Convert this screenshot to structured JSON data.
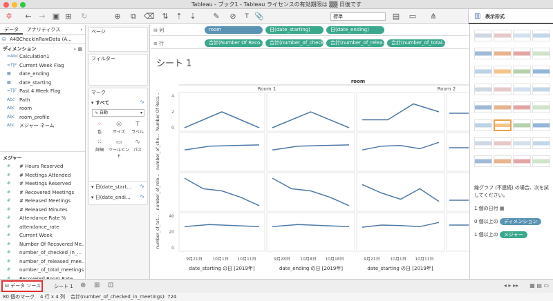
{
  "window": {
    "title": "Tableau - ブック1 - Tableau ライセンスの有効期限は ▒▒ 日後です"
  },
  "toolbar": {
    "mark_type_select": "標準",
    "show_me_label": "表示形式"
  },
  "left_panel": {
    "tabs": [
      "データ",
      "アナリティクス"
    ],
    "datasource": "A4BCheckInRawData (A...",
    "dimensions_header": "ディメンション",
    "dimensions": [
      {
        "icon": "=Abc",
        "name": "Calculation1"
      },
      {
        "icon": "T|F",
        "name": "Current Week Flag"
      },
      {
        "icon": "cal",
        "name": "date_ending"
      },
      {
        "icon": "cal",
        "name": "date_starting"
      },
      {
        "icon": "T|F",
        "name": "Past 4 Week Flag"
      },
      {
        "icon": "Abc",
        "name": "Path"
      },
      {
        "icon": "Abc",
        "name": "room"
      },
      {
        "icon": "Abc",
        "name": "room_profile"
      },
      {
        "icon": "Abc",
        "name": "メジャー ネーム"
      }
    ],
    "measures_header": "メジャー",
    "measures": [
      {
        "icon": "#",
        "name": "# Hours Reserved"
      },
      {
        "icon": "#",
        "name": "# Meetings Attended"
      },
      {
        "icon": "#",
        "name": "# Meetings Reserved"
      },
      {
        "icon": "#",
        "name": "# Recovered Meetings"
      },
      {
        "icon": "#",
        "name": "# Released Meetings"
      },
      {
        "icon": "#",
        "name": "# Released Minutes"
      },
      {
        "icon": "#",
        "name": "Attendance Rate %"
      },
      {
        "icon": "#",
        "name": "attendance_rate"
      },
      {
        "icon": "#",
        "name": "Current Week"
      },
      {
        "icon": "#",
        "name": "Number Of Recovered Me..."
      },
      {
        "icon": "#",
        "name": "number_of_checked_in_..."
      },
      {
        "icon": "#",
        "name": "number_of_released_mee..."
      },
      {
        "icon": "#",
        "name": "number_of_total_meetings"
      },
      {
        "icon": "#",
        "name": "Recovered Room Rate"
      }
    ]
  },
  "middle_panel": {
    "pages": "ページ",
    "filters": "フィルター",
    "marks": "マーク",
    "all": "すべて",
    "mark_type": "自動",
    "buttons": [
      "色",
      "サイズ",
      "ラベル",
      "詳細",
      "ツールヒント",
      "パス"
    ],
    "date_pills": [
      "日(date_start...",
      "日(date_endi..."
    ]
  },
  "shelves": {
    "columns_label": "列",
    "rows_label": "行",
    "columns": [
      "room",
      "日(date_starting)",
      "日(date_ending)"
    ],
    "rows": [
      "合計(Number Of Reco...",
      "合計(number_of_check...",
      "合計(number_of_relea...",
      "合計(number_of_total..."
    ]
  },
  "sheet": {
    "title": "シート 1",
    "top_header": "room",
    "rooms": [
      "Room 1",
      "Room 2"
    ],
    "row_axis_labels": [
      "Number Of Reco...",
      "number_of_che...",
      "number_of_rele...",
      "number_of_tot..."
    ],
    "ticks_row0": [
      "4",
      "2",
      "0"
    ],
    "ticks_row3": [
      "40",
      "20",
      "0"
    ],
    "x_ticks_start": [
      "9月21日",
      "10月1日",
      "10月11日"
    ],
    "x_ticks_end": [
      "9月28日",
      "10月8日",
      "10月18日"
    ],
    "x_label_start": "date_starting の日 [2019年]",
    "x_label_end": "date_ending の日 [2019年]"
  },
  "chart_data": {
    "type": "line",
    "series": [
      {
        "name": "Room 1 / date_starting / Number Of Recovered Meetings",
        "values": [
          0,
          2,
          0
        ]
      },
      {
        "name": "Room 1 / date_ending / Number Of Recovered Meetings",
        "values": [
          0,
          2,
          0
        ]
      },
      {
        "name": "Room 2 / date_starting / Number Of Recovered Meetings",
        "values": [
          1,
          1,
          3,
          2
        ]
      },
      {
        "name": "Room 1 / date_starting / number_of_checked_in",
        "values": [
          28,
          34,
          35,
          36
        ]
      },
      {
        "name": "Room 1 / date_ending / number_of_checked_in",
        "values": [
          28,
          34,
          35,
          36
        ]
      },
      {
        "name": "Room 2 / date_starting / number_of_checked_in",
        "values": [
          28,
          34,
          35,
          30,
          40
        ]
      },
      {
        "name": "Room 1 / date_starting / number_of_released",
        "values": [
          14,
          9,
          8,
          5,
          1
        ]
      },
      {
        "name": "Room 1 / date_ending / number_of_released",
        "values": [
          14,
          9,
          8,
          5,
          1
        ]
      },
      {
        "name": "Room 2 / date_starting / number_of_released",
        "values": [
          11,
          7,
          4,
          9,
          3
        ]
      },
      {
        "name": "Room 1 / date_starting / number_of_total_meetings",
        "values": [
          40,
          44,
          42,
          40
        ]
      },
      {
        "name": "Room 1 / date_ending / number_of_total_meetings",
        "values": [
          40,
          44,
          42,
          40
        ]
      },
      {
        "name": "Room 2 / date_starting / number_of_total_meetings",
        "values": [
          39,
          43,
          42,
          40,
          48
        ]
      }
    ]
  },
  "right_panel": {
    "hint": "線グラフ (不連続) の場合、次を試してください。",
    "req1": "1 個の日付",
    "req2_prefix": "0 個以上の",
    "req2_pill": "ディメンション",
    "req3_prefix": "1 個以上の",
    "req3_pill": "メジャー"
  },
  "bottom_tabs": {
    "datasource": "データ ソース",
    "sheet": "シート 1"
  },
  "status": {
    "marks": "80 個のマーク",
    "rows_cols": "4 行 x 4 列",
    "sum": "合計(number_of_checked_in_meetings): 724"
  },
  "colors": {
    "line": "#4e79a7",
    "dim_pill": "#5b93b5",
    "measure_pill": "#3aa88d",
    "highlight": "#e03030"
  }
}
